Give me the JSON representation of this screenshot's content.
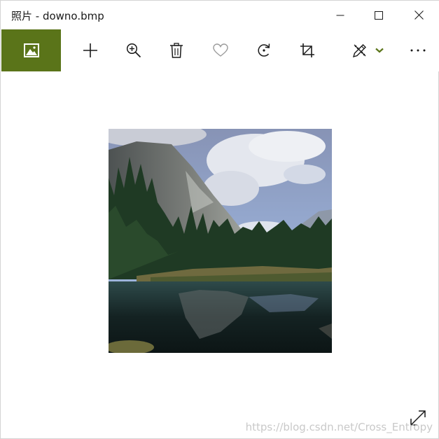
{
  "window": {
    "title": "照片 - downo.bmp",
    "controls": [
      "minimize-icon",
      "maximize-icon",
      "close-icon"
    ]
  },
  "toolbar": {
    "accent_color": "#5a7419",
    "items": [
      {
        "name": "see-all-photos",
        "icon": "photo-collection-icon"
      },
      {
        "name": "add-to",
        "icon": "plus-icon"
      },
      {
        "name": "zoom",
        "icon": "zoom-in-icon"
      },
      {
        "name": "delete",
        "icon": "trash-icon"
      },
      {
        "name": "favorite",
        "icon": "heart-icon"
      },
      {
        "name": "rotate",
        "icon": "rotate-icon"
      },
      {
        "name": "crop",
        "icon": "crop-icon"
      },
      {
        "name": "edit-and-create",
        "icon": "pen-ruler-icon"
      },
      {
        "name": "edit-dropdown",
        "icon": "chevron-down-icon"
      },
      {
        "name": "more",
        "icon": "more-icon"
      }
    ]
  },
  "viewer": {
    "image_subject": "mountain lake landscape",
    "fullscreen_icon": "expand-icon"
  },
  "watermark": {
    "text": "https://blog.csdn.net/Cross_Entropy"
  }
}
